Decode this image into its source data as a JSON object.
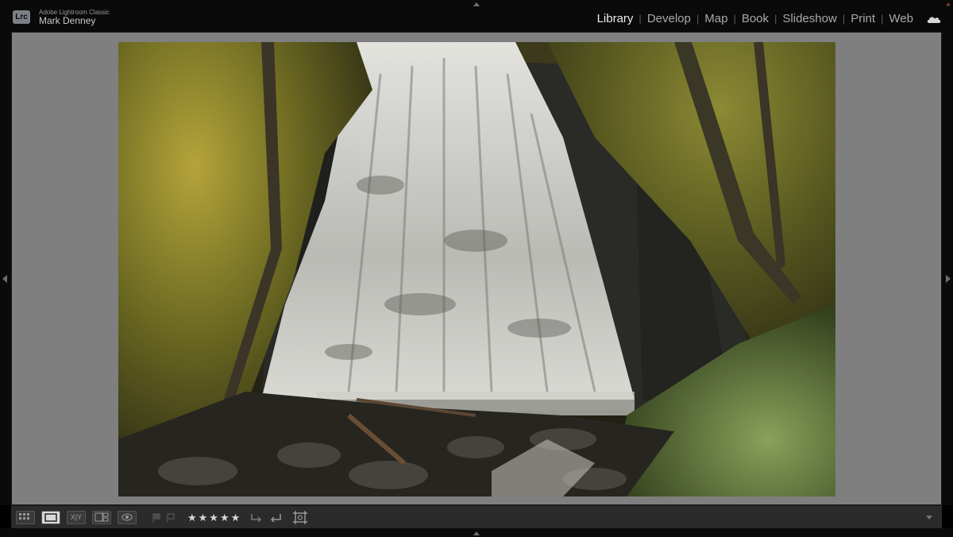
{
  "app": {
    "badge": "Lrc",
    "product": "Adobe Lightroom Classic",
    "user": "Mark Denney"
  },
  "modules": [
    {
      "label": "Library",
      "active": true
    },
    {
      "label": "Develop",
      "active": false
    },
    {
      "label": "Map",
      "active": false
    },
    {
      "label": "Book",
      "active": false
    },
    {
      "label": "Slideshow",
      "active": false
    },
    {
      "label": "Print",
      "active": false
    },
    {
      "label": "Web",
      "active": false
    }
  ],
  "separator": "|",
  "toolbar": {
    "view_buttons": [
      "grid-view-icon",
      "loupe-view-icon",
      "compare-view-icon",
      "survey-view-icon",
      "people-view-icon"
    ],
    "compare_label": "X|Y",
    "rating": "★★★★★",
    "rating_value": 5,
    "rating_max": 5
  },
  "photo": {
    "subject": "waterfall"
  },
  "colors": {
    "background": "#7f7f7f",
    "panel": "#0a0a0a",
    "toolbar": "#2b2b2b",
    "active_module": "#ececec",
    "inactive_module": "#a9a9a9"
  }
}
